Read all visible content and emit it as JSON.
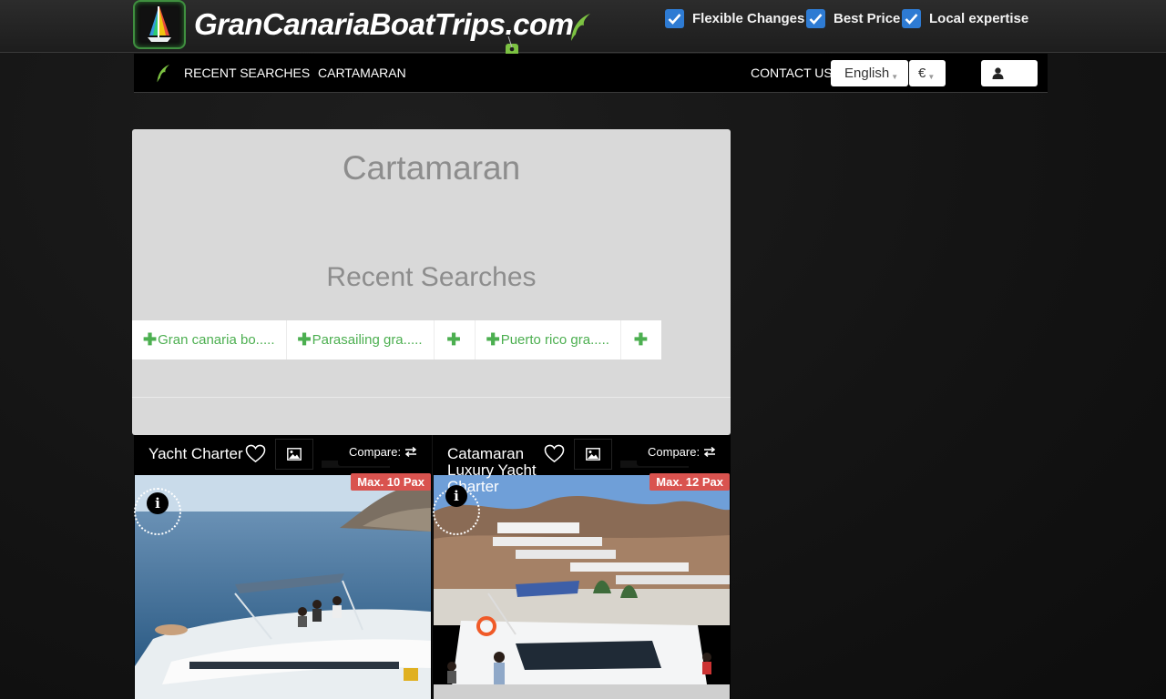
{
  "header": {
    "logo_text": "GranCanariaBoatTrips.com",
    "features": [
      {
        "label": "Flexible Changes"
      },
      {
        "label": "Best Price"
      },
      {
        "label": "Local expertise"
      }
    ]
  },
  "nav": {
    "links": [
      "RECENT SEARCHES",
      "CARTAMARAN"
    ],
    "contact": "CONTACT US",
    "language": "English",
    "currency": "€"
  },
  "panel": {
    "title": "Cartamaran",
    "subtitle": "Recent Searches",
    "recent": [
      {
        "plus": "✚",
        "label": "Gran canaria bo....."
      },
      {
        "plus": "✚",
        "label": "Parasailing gra....."
      },
      {
        "plus": "✚",
        "label": ""
      },
      {
        "plus": "✚",
        "label": "Puerto rico gra....."
      },
      {
        "plus": "✚",
        "label": ""
      }
    ]
  },
  "cards": [
    {
      "title": "Yacht Charter",
      "compare": "Compare:",
      "pax": "Max. 10 Pax"
    },
    {
      "title": "Catamaran Luxury Yacht Charter",
      "compare": "Compare:",
      "pax": "Max. 12 Pax"
    }
  ],
  "colors": {
    "accent_green": "#4caf50",
    "checkbox_blue": "#2e7bd3",
    "badge_red": "#d9534f"
  },
  "icons": [
    "sailboat-logo-icon",
    "dolphin-icon",
    "price-tag-icon",
    "check-icon",
    "user-icon",
    "heart-icon",
    "image-icon",
    "swap-icon",
    "info-icon"
  ]
}
